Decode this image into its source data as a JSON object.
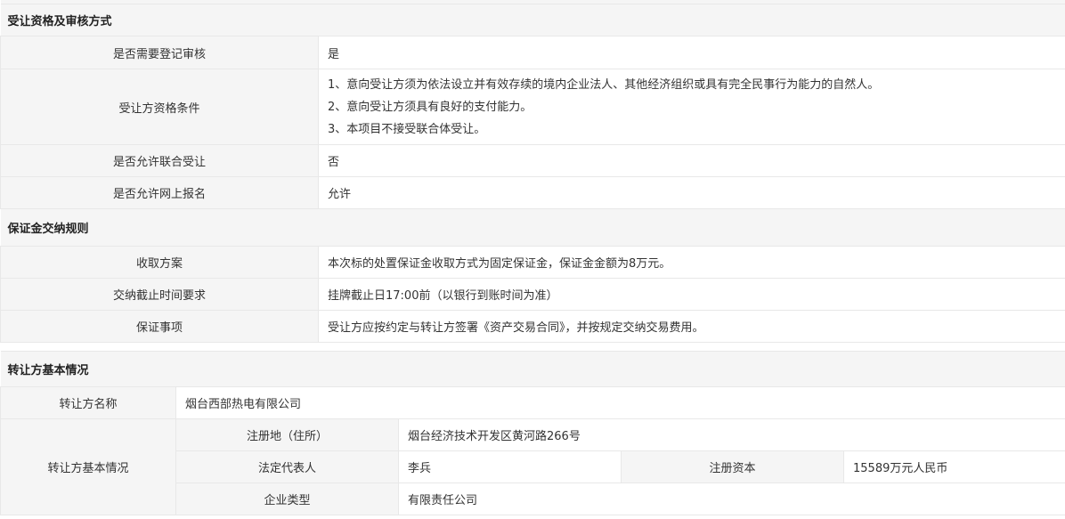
{
  "section1": {
    "title": "受让资格及审核方式",
    "rows": [
      {
        "label": "是否需要登记审核",
        "value": "是"
      },
      {
        "label": "受让方资格条件",
        "lines": [
          "1、意向受让方须为依法设立并有效存续的境内企业法人、其他经济组织或具有完全民事行为能力的自然人。",
          "2、意向受让方须具有良好的支付能力。",
          "3、本项目不接受联合体受让。"
        ]
      },
      {
        "label": "是否允许联合受让",
        "value": "否"
      },
      {
        "label": "是否允许网上报名",
        "value": "允许"
      }
    ]
  },
  "section2": {
    "title": "保证金交纳规则",
    "rows": [
      {
        "label": "收取方案",
        "value": "本次标的处置保证金收取方式为固定保证金，保证金金额为8万元。"
      },
      {
        "label": "交纳截止时间要求",
        "value": "挂牌截止日17:00前（以银行到账时间为准）"
      },
      {
        "label": "保证事项",
        "value": "受让方应按约定与转让方签署《资产交易合同》，并按规定交纳交易费用。"
      }
    ]
  },
  "section3": {
    "title": "转让方基本情况",
    "name_label": "转让方名称",
    "name_value": "烟台西部热电有限公司",
    "group_label": "转让方基本情况",
    "address_label": "注册地（住所）",
    "address_value": "烟台经济技术开发区黄河路266号",
    "legal_rep_label": "法定代表人",
    "legal_rep_value": "李兵",
    "capital_label": "注册资本",
    "capital_value": "15589万元人民币",
    "type_label": "企业类型",
    "type_value": "有限责任公司"
  }
}
